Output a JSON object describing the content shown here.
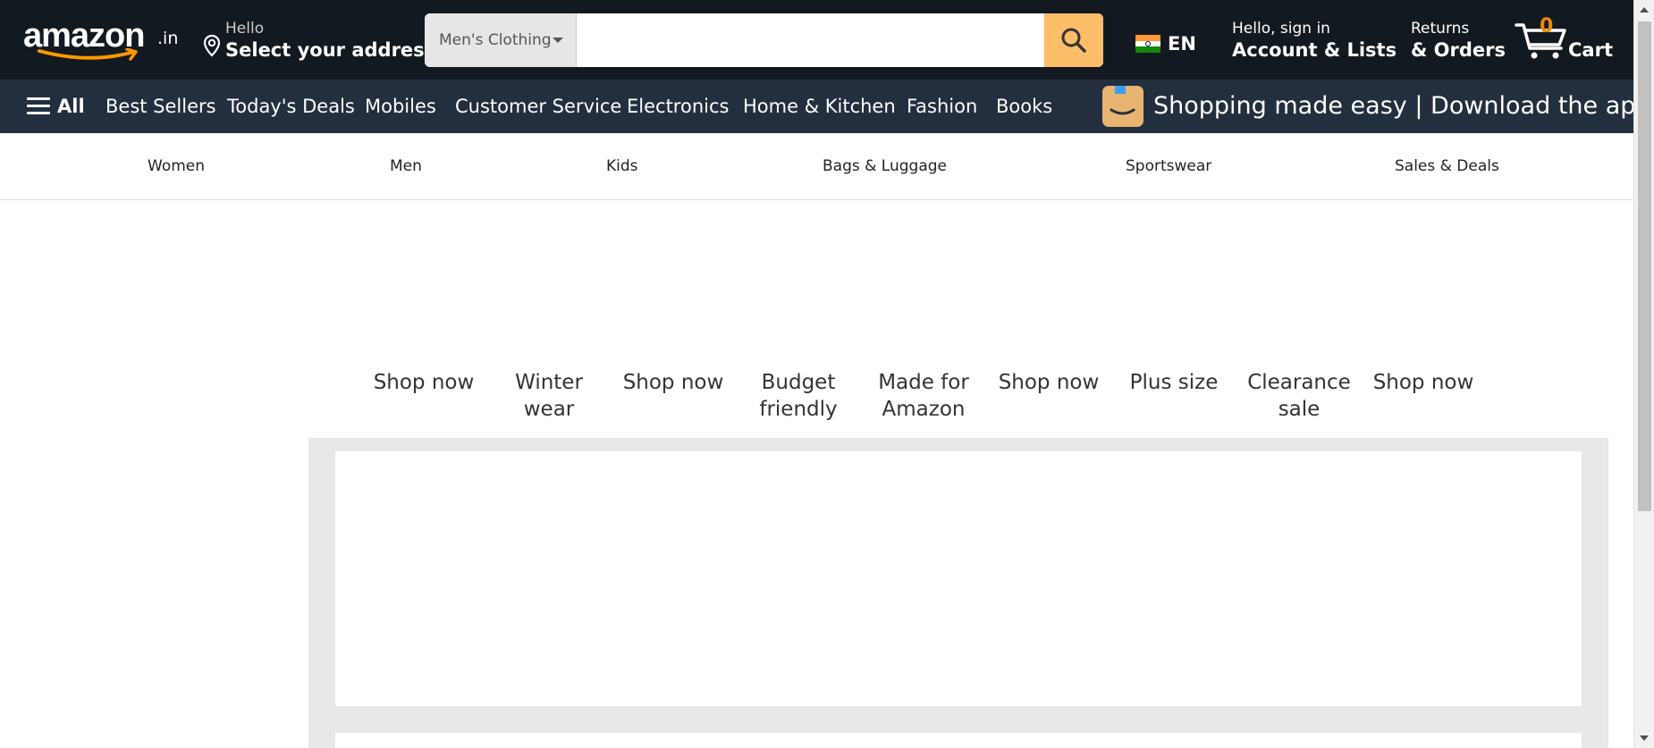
{
  "header": {
    "logo_text": "amazon",
    "logo_tld": ".in",
    "address_hello": "Hello",
    "address_action": "Select your address",
    "search": {
      "category": "Men's Clothing",
      "value": "",
      "placeholder": ""
    },
    "language": "EN",
    "account_line1": "Hello, sign in",
    "account_line2": "Account & Lists",
    "orders_line1": "Returns",
    "orders_line2": "& Orders",
    "cart_count": "0",
    "cart_label": "Cart"
  },
  "subnav": {
    "all_label": "All",
    "items": [
      "Best Sellers",
      "Today's Deals",
      "Mobiles",
      "Customer Service",
      "Electronics",
      "Home & Kitchen",
      "Fashion",
      "Books"
    ],
    "promo_text": "Shopping made easy | Download the app"
  },
  "categories": [
    "Women",
    "Men",
    "Kids",
    "Bags & Luggage",
    "Sportswear",
    "Sales & Deals"
  ],
  "tiles": [
    "Shop now",
    "Winter wear",
    "Shop now",
    "Budget friendly",
    "Made for Amazon",
    "Shop now",
    "Plus size",
    "Clearance sale",
    "Shop now"
  ],
  "colors": {
    "nav_bg": "#131921",
    "subnav_bg": "#232f3e",
    "search_button": "#febd69",
    "cart_count": "#f08804",
    "panel_bg": "#e8e8e8"
  },
  "icons": {
    "location": "location-pin-icon",
    "search": "search-icon",
    "flag": "india-flag-icon",
    "cart": "cart-icon",
    "menu": "hamburger-menu-icon"
  }
}
